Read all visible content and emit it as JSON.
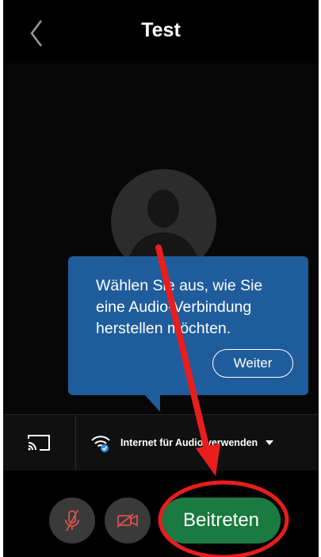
{
  "header": {
    "title": "Test",
    "back_icon": "chevron-left-icon"
  },
  "tooltip": {
    "line1": "Wählen Sie aus, wie Sie",
    "line2": "eine Audio-Verbindung",
    "line3": "herstellen möchten.",
    "weiter_label": "Weiter"
  },
  "audio": {
    "cast_icon": "cast-icon",
    "wifi_icon": "wifi-icon",
    "select_label": "Internet für Audio verwenden",
    "caret_icon": "caret-down-icon"
  },
  "controls": {
    "mute_icon": "microphone-muted-icon",
    "video_icon": "video-off-icon",
    "join_label": "Beitreten"
  },
  "colors": {
    "tooltip_bg": "#1f5c9c",
    "join_green": "#1a7a3f",
    "annotation_red": "#ea1d1d",
    "muted_icon": "#d9534f"
  }
}
